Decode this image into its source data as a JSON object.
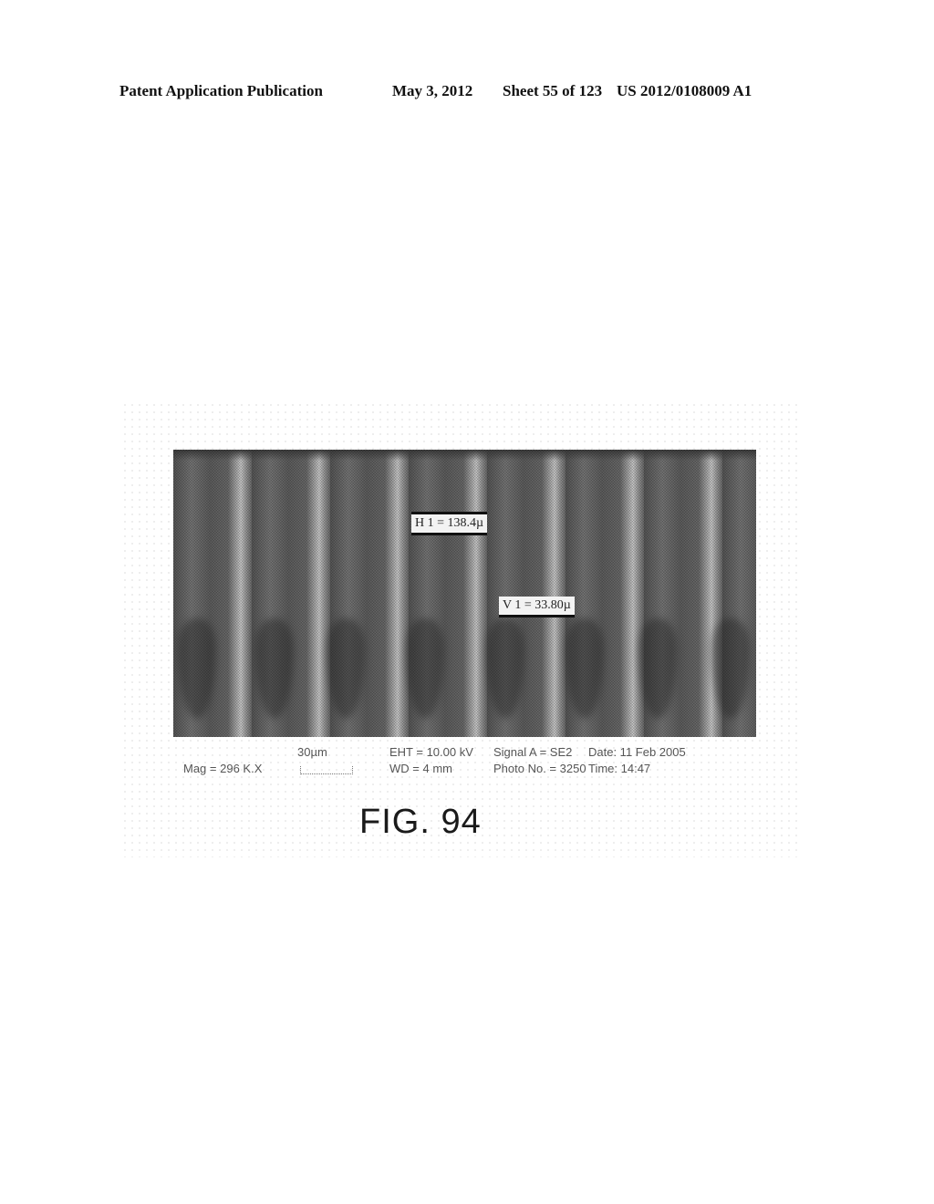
{
  "header": {
    "publication": "Patent Application Publication",
    "date": "May 3, 2012",
    "sheet": "Sheet 55 of 123",
    "number": "US 2012/0108009 A1"
  },
  "figure": {
    "label": "FIG. 94",
    "image_description": "SEM cross-section micrograph showing vertical columnar pores",
    "measurements": {
      "h1": "H 1 = 138.4µ",
      "v1": "V 1 = 33.80µ"
    },
    "info_bar": {
      "mag": "Mag = 296 K.X",
      "scale_bar_label": "30µm",
      "eht": "EHT = 10.00 kV",
      "signal": "Signal A = SE2",
      "date": "Date: 11 Feb 2005",
      "wd": "WD =  4 mm",
      "photo_no": "Photo No. = 3250",
      "time": "Time: 14:47"
    }
  }
}
